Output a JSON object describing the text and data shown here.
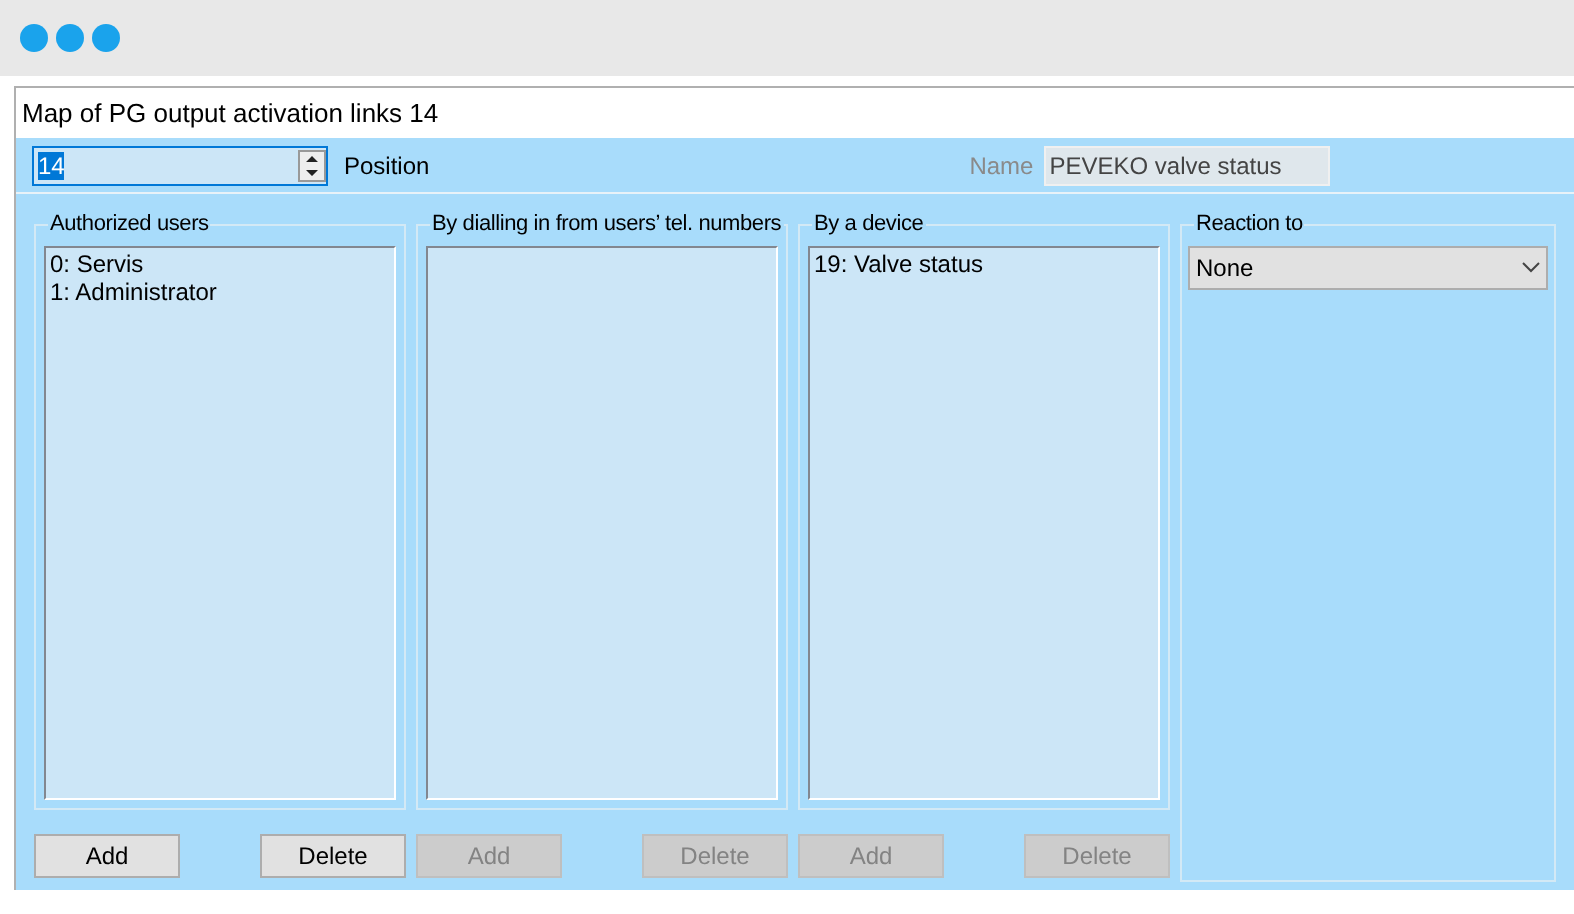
{
  "window": {
    "title": "Map of PG output activation links 14"
  },
  "position": {
    "value": "14",
    "label": "Position"
  },
  "name": {
    "label": "Name",
    "value": "PEVEKO valve status",
    "disabled": true
  },
  "groups": [
    {
      "kind": "list",
      "title": "Authorized users",
      "items": [
        "0: Servis",
        "1: Administrator"
      ],
      "buttons": [
        {
          "label": "Add",
          "disabled": false
        },
        {
          "label": "Delete",
          "disabled": false
        }
      ]
    },
    {
      "kind": "list",
      "title": "By dialling in from users’ tel. numbers",
      "buttons": [
        {
          "label": "Add",
          "disabled": true
        },
        {
          "label": "Delete",
          "disabled": true
        }
      ]
    },
    {
      "kind": "list",
      "title": "By a device",
      "items": [
        "19: Valve status"
      ],
      "buttons": [
        {
          "label": "Add",
          "disabled": true
        },
        {
          "label": "Delete",
          "disabled": true
        }
      ]
    },
    {
      "kind": "dropdown",
      "title": "Reaction to",
      "value": "None"
    }
  ]
}
